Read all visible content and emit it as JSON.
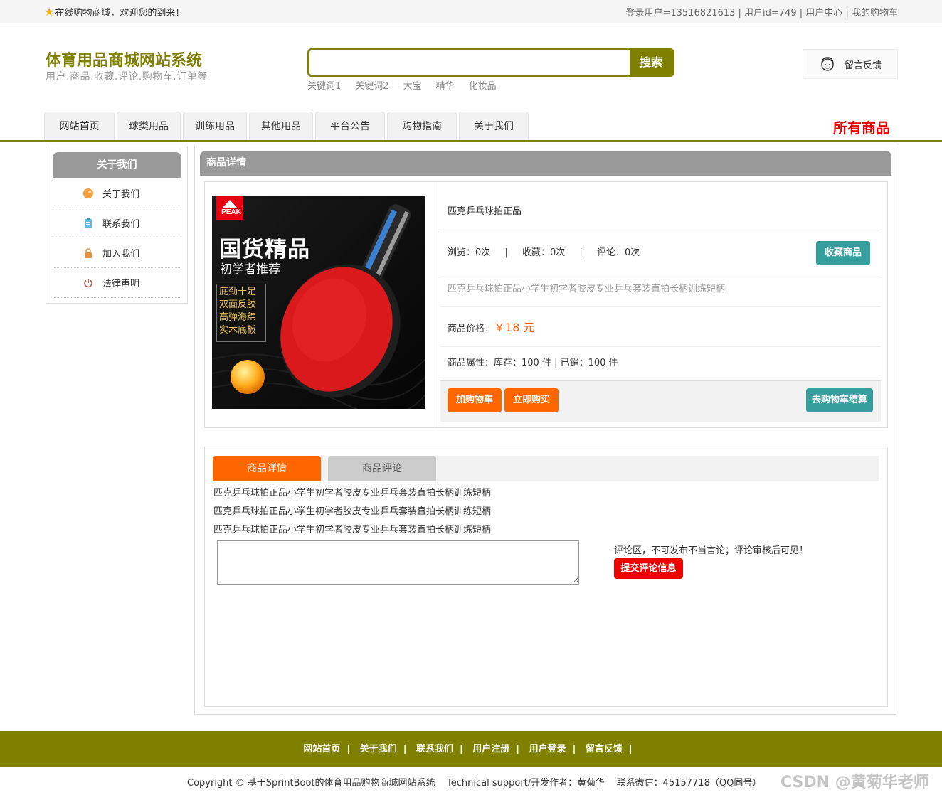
{
  "topbar": {
    "welcome": "在线购物商城，欢迎您的到来！",
    "user": "登录用户=13516821613",
    "user_id": "用户id=749",
    "user_center": "用户中心",
    "cart": "我的购物车",
    "sep": "|"
  },
  "header": {
    "title": "体育用品商城网站系统",
    "subtitle": "用户.商品.收藏.评论.购物车.订单等",
    "search_placeholder": "",
    "search_button": "搜索",
    "keywords": [
      "关键词1",
      "关键词2",
      "大宝",
      "精华",
      "化妆品"
    ],
    "feedback": "留言反馈"
  },
  "nav": {
    "items": [
      "网站首页",
      "球类用品",
      "训练用品",
      "其他用品",
      "平台公告",
      "购物指南",
      "关于我们"
    ],
    "all_products": "所有商品"
  },
  "sidebar": {
    "title": "关于我们",
    "items": [
      "关于我们",
      "联系我们",
      "加入我们",
      "法律声明"
    ]
  },
  "product": {
    "section_title": "商品详情",
    "image": {
      "brand": "PEAK",
      "headline": "国货精品",
      "subheadline": "初学者推荐",
      "features": [
        "底劲十足",
        "双面反胶",
        "高弹海绵",
        "实木底板"
      ]
    },
    "name": "匹克乒乓球拍正品",
    "views_label": "浏览：",
    "views": "0次",
    "favorites_label": "收藏：",
    "favorites": "0次",
    "comments_label": "评论：",
    "comments": "0次",
    "favorite_button": "收藏商品",
    "description": "匹克乒乓球拍正品小学生初学者胶皮专业乒乓套装直拍长柄训练短柄",
    "price_label": "商品价格：",
    "price": "￥18 元",
    "attr_label": "商品属性：",
    "attrs": "库存：100 件 | 已销：100 件",
    "add_cart_button": "加购物车",
    "buy_now_button": "立即购买",
    "checkout_button": "去购物车结算"
  },
  "details": {
    "tab_detail": "商品详情",
    "tab_comments": "商品评论",
    "lines": [
      "匹克乒乓球拍正品小学生初学者胶皮专业乒乓套装直拍长柄训练短柄",
      "匹克乒乓球拍正品小学生初学者胶皮专业乒乓套装直拍长柄训练短柄",
      "匹克乒乓球拍正品小学生初学者胶皮专业乒乓套装直拍长柄训练短柄"
    ],
    "comment_value": "",
    "comment_note": "评论区，不可发布不当言论；评论审核后可见！",
    "submit_button": "提交评论信息"
  },
  "footer": {
    "links": [
      "网站首页",
      "关于我们",
      "联系我们",
      "用户注册",
      "用户登录",
      "留言反馈"
    ],
    "sep": "|",
    "copyright": "Copyright © 基于SprintBoot的体育用品购物商城网站系统    Technical support/开发作者：黄菊华    联系微信：45157718（QQ同号）",
    "watermark": "CSDN @黄菊华老师"
  },
  "colors": {
    "brand_olive": "#808000",
    "accent_orange": "#ff6600",
    "teal": "#379e9e",
    "red": "#ee0000",
    "price": "#ff5500"
  }
}
